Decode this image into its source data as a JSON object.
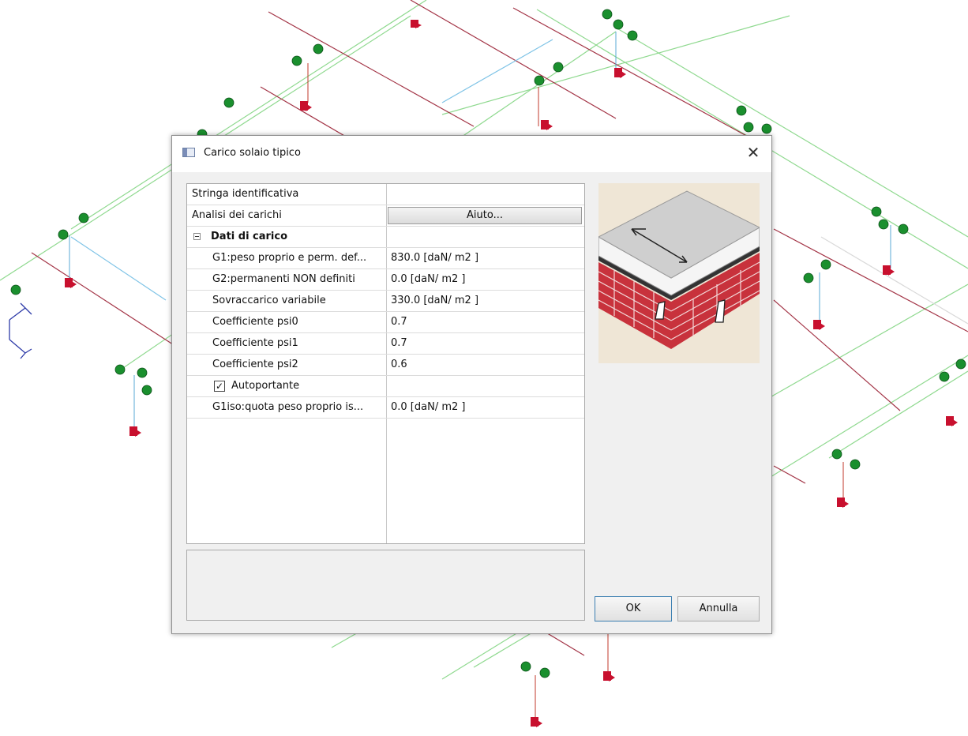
{
  "dialog": {
    "title": "Carico solaio tipico",
    "close_glyph": "✕",
    "icon": "window-icon"
  },
  "properties": {
    "row_identifier": {
      "label": "Stringa identificativa",
      "value": ""
    },
    "row_analysis": {
      "label": "Analisi dei carichi",
      "button_label": "Aiuto..."
    },
    "category": {
      "label": "Dati di carico",
      "expander_icon": "collapse-minus-icon"
    },
    "items": [
      {
        "label": "G1:peso proprio e perm. def...",
        "value": "830.0  [daN/ m2 ]"
      },
      {
        "label": "G2:permanenti NON definiti",
        "value": "0.0  [daN/ m2 ]"
      },
      {
        "label": "Sovraccarico variabile",
        "value": "330.0  [daN/ m2 ]"
      },
      {
        "label": "Coefficiente psi0",
        "value": "0.7"
      },
      {
        "label": "Coefficiente psi1",
        "value": "0.7"
      },
      {
        "label": "Coefficiente psi2",
        "value": "0.6"
      }
    ],
    "autoportante": {
      "label": "Autoportante",
      "checked": true,
      "check_glyph": "✓"
    },
    "g1iso": {
      "label": "G1iso:quota peso proprio is...",
      "value": "0.0  [daN/ m2 ]"
    }
  },
  "buttons": {
    "ok": "OK",
    "cancel": "Annulla"
  },
  "colors": {
    "background_green_line": "#7fd07f",
    "background_red_line": "#9b2a3a",
    "node_green": "#1a8f2e",
    "support_red": "#c8102e",
    "preview_bg": "#efe6d6"
  }
}
